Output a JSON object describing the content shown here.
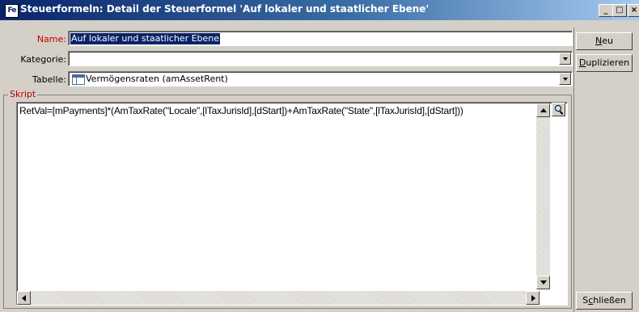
{
  "window": {
    "title": "Steuerformeln: Detail der Steuerformel 'Auf lokaler und staatlicher Ebene'",
    "app_icon_text": "Fe",
    "controls": {
      "minimize": "_",
      "maximize": "□",
      "close": "×"
    }
  },
  "form": {
    "name_label": "Name:",
    "name_value": "Auf lokaler und staatlicher Ebene",
    "category_label": "Kategorie:",
    "category_value": "",
    "table_label": "Tabelle:",
    "table_value": "Vermögensraten (amAssetRent)"
  },
  "script": {
    "group_label": "Skript",
    "code": "RetVal=[mPayments]*(AmTaxRate(\"Locale\",[lTaxJurisId],[dStart])+AmTaxRate(\"State\",[lTaxJurisId],[dStart]))"
  },
  "buttons": {
    "new": {
      "mnemonic": "N",
      "rest": "eu"
    },
    "duplicate": {
      "mnemonic": "D",
      "rest": "uplizieren"
    },
    "close": {
      "pre": "S",
      "mnemonic": "c",
      "rest": "hließen"
    }
  },
  "colors": {
    "title_gradient_start": "#0a246a",
    "title_gradient_end": "#a6caf0",
    "required_label": "#c00000",
    "selection": "#0a246a",
    "face": "#d4d0c8"
  },
  "icons": [
    "app-icon",
    "minimize-icon",
    "maximize-icon",
    "close-icon",
    "dropdown-arrow-icon",
    "table-icon",
    "magnifier-icon",
    "scroll-arrow-icon"
  ]
}
